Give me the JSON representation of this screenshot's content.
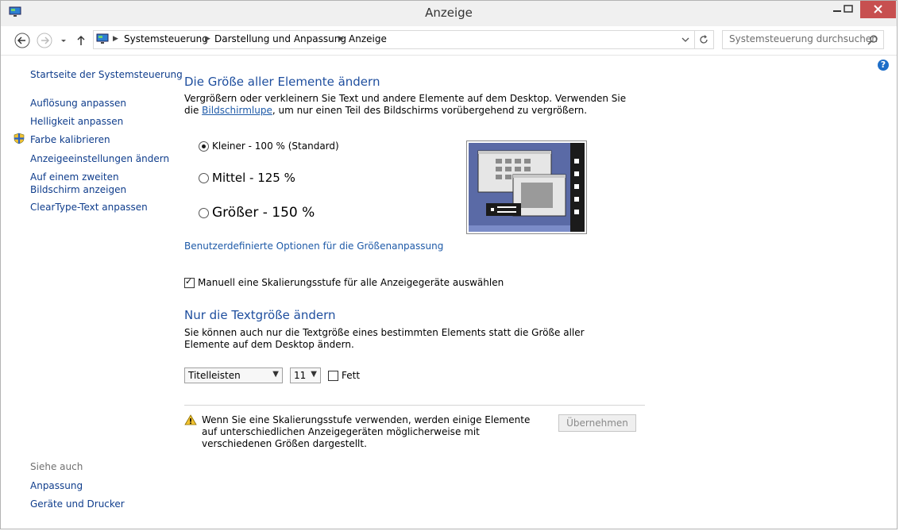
{
  "window": {
    "title": "Anzeige"
  },
  "address": {
    "crumbs": [
      "Systemsteuerung",
      "Darstellung und Anpassung",
      "Anzeige"
    ],
    "search_placeholder": "Systemsteuerung durchsuchen"
  },
  "sidebar": {
    "home": "Startseite der Systemsteuerung",
    "items": [
      {
        "label": "Auflösung anpassen"
      },
      {
        "label": "Helligkeit anpassen"
      },
      {
        "label": "Farbe kalibrieren",
        "icon": "shield-icon"
      },
      {
        "label": "Anzeigeeinstellungen ändern"
      },
      {
        "label": "Auf einem zweiten Bildschirm anzeigen"
      },
      {
        "label": "ClearType-Text anpassen"
      }
    ],
    "see_also_label": "Siehe auch",
    "see_also": [
      {
        "label": "Anpassung"
      },
      {
        "label": "Geräte und Drucker"
      }
    ]
  },
  "main": {
    "heading1": "Die Größe aller Elemente ändern",
    "desc1_pre": "Vergrößern oder verkleinern Sie Text und andere Elemente auf dem Desktop. Verwenden Sie die",
    "desc1_link": "Bildschirmlupe",
    "desc1_post": ", um nur einen Teil des Bildschirms vorübergehend zu vergrößern.",
    "radios": [
      {
        "label": "Kleiner - 100 % (Standard)",
        "checked": true
      },
      {
        "label": "Mittel - 125 %",
        "checked": false
      },
      {
        "label": "Größer - 150 %",
        "checked": false
      }
    ],
    "custom_link": "Benutzerdefinierte Optionen für die Größenanpassung",
    "manual_checkbox": {
      "label": "Manuell eine Skalierungsstufe für alle Anzeigegeräte auswählen",
      "checked": true
    },
    "heading2": "Nur die Textgröße ändern",
    "desc2": "Sie können auch nur die Textgröße eines bestimmten Elements statt die Größe aller Elemente auf dem Desktop ändern.",
    "element_select": "Titelleisten",
    "size_select": "11",
    "bold_label": "Fett",
    "warning": "Wenn Sie eine Skalierungsstufe verwenden, werden einige Elemente auf unterschiedlichen Anzeigegeräten möglicherweise mit verschiedenen Größen dargestellt.",
    "apply_button": "Übernehmen"
  },
  "colors": {
    "link": "#1e5aa8",
    "heading": "#1e4e9e",
    "close": "#c75050",
    "preview_bg": "#5a6aa6"
  }
}
